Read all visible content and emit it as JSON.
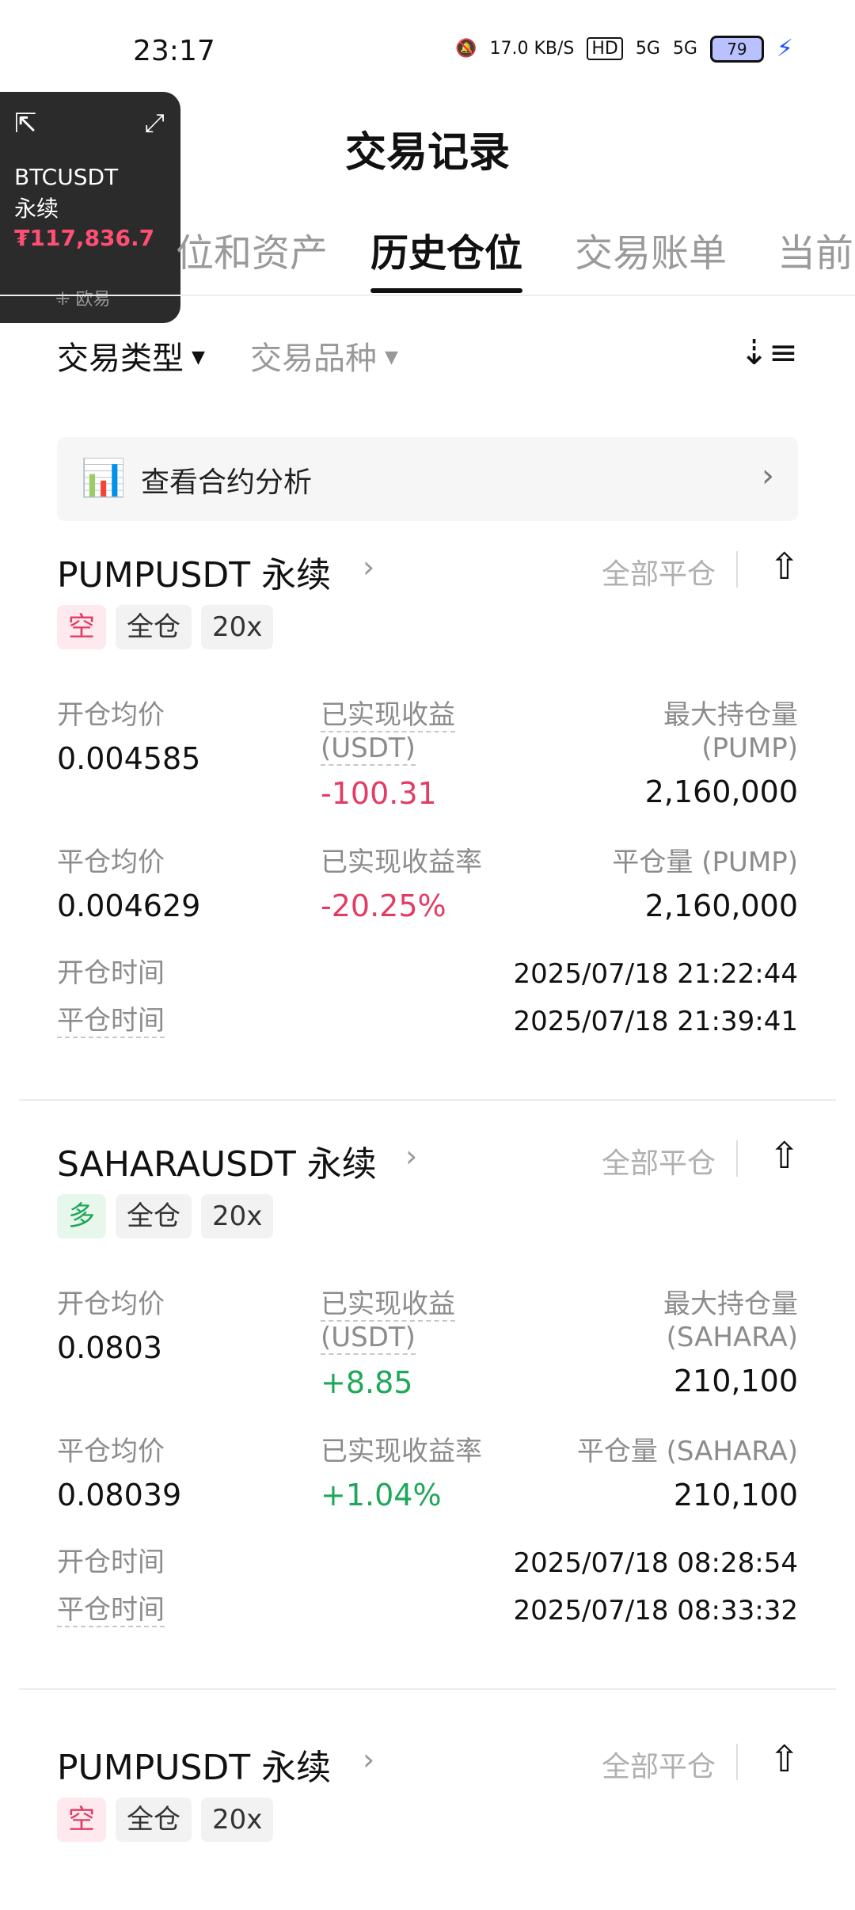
{
  "status": {
    "time": "23:17",
    "net_speed": "17.0 KB/S",
    "hd": "HD",
    "sig1": "5G",
    "sig2": "5G",
    "battery": "79"
  },
  "pip": {
    "symbol_line1": "BTCUSDT",
    "symbol_line2": "永续",
    "price": "₮117,836.7",
    "brand": "欧易"
  },
  "title": "交易记录",
  "tabs": [
    "位和资产",
    "历史仓位",
    "交易账单",
    "当前"
  ],
  "filters": {
    "type": "交易类型",
    "instrument": "交易品种"
  },
  "analysis": {
    "label": "查看合约分析"
  },
  "cards": [
    {
      "name": "PUMPUSDT 永续",
      "close_all": "全部平仓",
      "side": "空",
      "margin": "全仓",
      "leverage": "20x",
      "labels": {
        "open_avg": "开仓均价",
        "pnl_l1": "已实现收益",
        "pnl_l2": "(USDT)",
        "max_l1": "最大持仓量",
        "max_l2": "(PUMP)",
        "close_avg": "平仓均价",
        "pnl_rate": "已实现收益率",
        "close_qty": "平仓量 (PUMP)",
        "open_time": "开仓时间",
        "close_time": "平仓时间"
      },
      "open_avg": "0.004585",
      "pnl": "-100.31",
      "max_qty": "2,160,000",
      "close_avg": "0.004629",
      "pnl_rate": "-20.25%",
      "close_qty": "2,160,000",
      "open_time": "2025/07/18 21:22:44",
      "close_time": "2025/07/18 21:39:41"
    },
    {
      "name": "SAHARAUSDT 永续",
      "close_all": "全部平仓",
      "side": "多",
      "margin": "全仓",
      "leverage": "20x",
      "labels": {
        "open_avg": "开仓均价",
        "pnl_l1": "已实现收益",
        "pnl_l2": "(USDT)",
        "max_l1": "最大持仓量",
        "max_l2": "(SAHARA)",
        "close_avg": "平仓均价",
        "pnl_rate": "已实现收益率",
        "close_qty": "平仓量 (SAHARA)",
        "open_time": "开仓时间",
        "close_time": "平仓时间"
      },
      "open_avg": "0.0803",
      "pnl": "+8.85",
      "max_qty": "210,100",
      "close_avg": "0.08039",
      "pnl_rate": "+1.04%",
      "close_qty": "210,100",
      "open_time": "2025/07/18 08:28:54",
      "close_time": "2025/07/18 08:33:32"
    },
    {
      "name": "PUMPUSDT 永续",
      "close_all": "全部平仓",
      "side": "空",
      "margin": "全仓",
      "leverage": "20x"
    }
  ],
  "colors": {
    "short": "#e23c64",
    "long": "#1ea759"
  }
}
